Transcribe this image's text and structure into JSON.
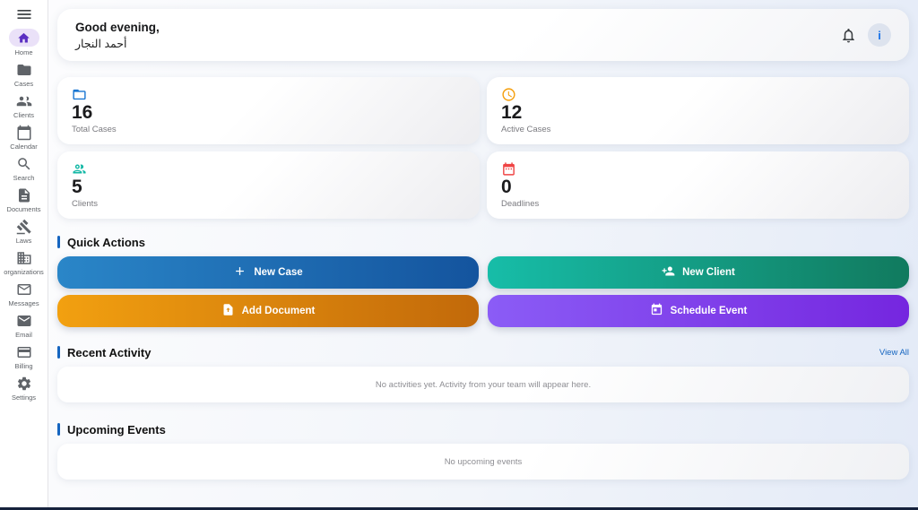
{
  "colors": {
    "accent_blue": "#1565c0",
    "active_nav_purple": "#5a2fc2",
    "active_nav_pill": "#eae1f8",
    "bottom_bar": "#16223c",
    "info_icon_blue": "#1a73e8"
  },
  "sidebar": {
    "items": [
      {
        "label": "Home",
        "icon": "home-icon",
        "active": true
      },
      {
        "label": "Cases",
        "icon": "folder-icon",
        "active": false
      },
      {
        "label": "Clients",
        "icon": "people-icon",
        "active": false
      },
      {
        "label": "Calendar",
        "icon": "calendar-icon",
        "active": false
      },
      {
        "label": "Search",
        "icon": "search-icon",
        "active": false
      },
      {
        "label": "Documents",
        "icon": "document-icon",
        "active": false
      },
      {
        "label": "Laws",
        "icon": "gavel-icon",
        "active": false
      },
      {
        "label": "organizations",
        "icon": "building-icon",
        "active": false
      },
      {
        "label": "Messages",
        "icon": "mail-outline-icon",
        "active": false
      },
      {
        "label": "Email",
        "icon": "mail-filled-icon",
        "active": false
      },
      {
        "label": "Billing",
        "icon": "credit-card-icon",
        "active": false
      },
      {
        "label": "Settings",
        "icon": "gear-icon",
        "active": false
      }
    ]
  },
  "header": {
    "greeting": "Good evening,",
    "username": "أحمد النجار",
    "bell_icon": "bell-icon",
    "info_label": "i"
  },
  "stats": [
    {
      "value": "16",
      "label": "Total Cases",
      "icon": "folder-icon",
      "color": "#1976d2"
    },
    {
      "value": "12",
      "label": "Active Cases",
      "icon": "clock-icon",
      "color": "#f59e0b"
    },
    {
      "value": "5",
      "label": "Clients",
      "icon": "people-icon",
      "color": "#14b8a6"
    },
    {
      "value": "0",
      "label": "Deadlines",
      "icon": "calendar-icon",
      "color": "#ef4444"
    }
  ],
  "quick_actions": {
    "title": "Quick Actions",
    "buttons": [
      {
        "label": "New Case",
        "icon": "plus-icon",
        "gradient": [
          "#2a86c8",
          "#14549e"
        ]
      },
      {
        "label": "New Client",
        "icon": "person-add-icon",
        "gradient": [
          "#17bda8",
          "#117a5e"
        ]
      },
      {
        "label": "Add Document",
        "icon": "upload-file-icon",
        "gradient": [
          "#f2a010",
          "#c2690a"
        ]
      },
      {
        "label": "Schedule Event",
        "icon": "event-icon",
        "gradient": [
          "#8b5cf6",
          "#7526df"
        ]
      }
    ]
  },
  "recent_activity": {
    "title": "Recent Activity",
    "view_all": "View All",
    "empty_message": "No activities yet. Activity from your team will appear here."
  },
  "upcoming_events": {
    "title": "Upcoming Events",
    "empty_message": "No upcoming events"
  }
}
